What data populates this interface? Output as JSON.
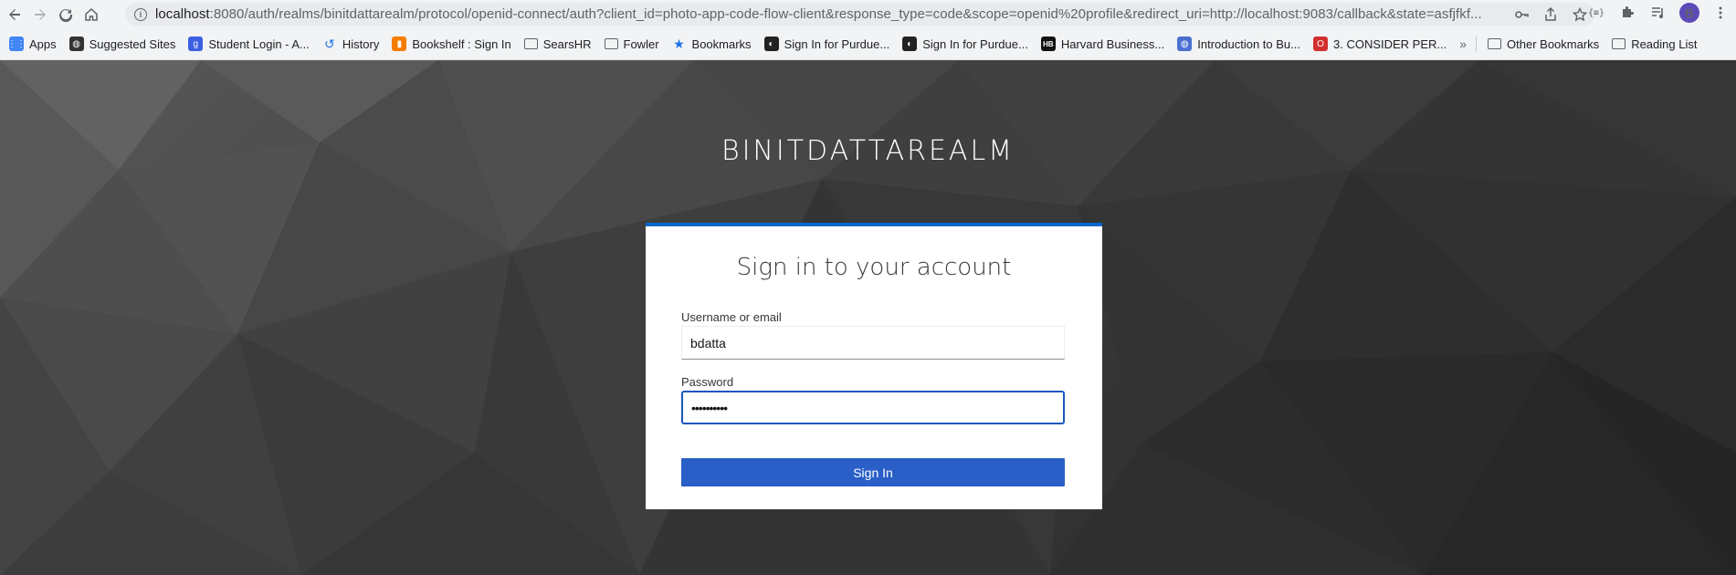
{
  "browser": {
    "url_host": "localhost",
    "url_path": ":8080/auth/realms/binitdattarealm/protocol/openid-connect/auth?client_id=photo-app-code-flow-client&response_type=code&scope=openid%20profile&redirect_uri=http://localhost:9083/callback&state=asfjfkf...",
    "avatar_initial": "B"
  },
  "bookmarks": [
    {
      "label": "Apps",
      "icon": "apps-grid-icon",
      "color": "#4285f4"
    },
    {
      "label": "Suggested Sites",
      "icon": "globe-icon",
      "color": "#333333"
    },
    {
      "label": "Student Login - A...",
      "icon": "g-icon",
      "color": "#3b5fe0"
    },
    {
      "label": "History",
      "icon": "history-icon",
      "color": "#1a73e8"
    },
    {
      "label": "Bookshelf : Sign In",
      "icon": "bookshelf-icon",
      "color": "#f57c00"
    },
    {
      "label": "SearsHR",
      "icon": "folder-icon",
      "color": "#5f6368"
    },
    {
      "label": "Fowler",
      "icon": "folder-icon",
      "color": "#5f6368"
    },
    {
      "label": "Bookmarks",
      "icon": "star-icon",
      "color": "#1a73e8"
    },
    {
      "label": "Sign In for Purdue...",
      "icon": "purdue-icon",
      "color": "#222222"
    },
    {
      "label": "Sign In for Purdue...",
      "icon": "purdue-icon",
      "color": "#222222"
    },
    {
      "label": "Harvard Business...",
      "icon": "hb-icon",
      "color": "#111111"
    },
    {
      "label": "Introduction to Bu...",
      "icon": "globe-icon",
      "color": "#4a6fd0"
    },
    {
      "label": "3. CONSIDER PER...",
      "icon": "o-icon",
      "color": "#d32f2f"
    }
  ],
  "bookmarks_overflow": "»",
  "bookmarks_right": [
    {
      "label": "Other Bookmarks",
      "icon": "folder-icon"
    },
    {
      "label": "Reading List",
      "icon": "reading-list-icon"
    }
  ],
  "realm_title": "BINITDATTAREALM",
  "login": {
    "title": "Sign in to your account",
    "username_label": "Username or email",
    "username_value": "bdatta",
    "password_label": "Password",
    "password_value": "••••••••••",
    "submit_label": "Sign In"
  },
  "colors": {
    "accent": "#2a5fc7",
    "card_top_border": "#0066cc"
  }
}
